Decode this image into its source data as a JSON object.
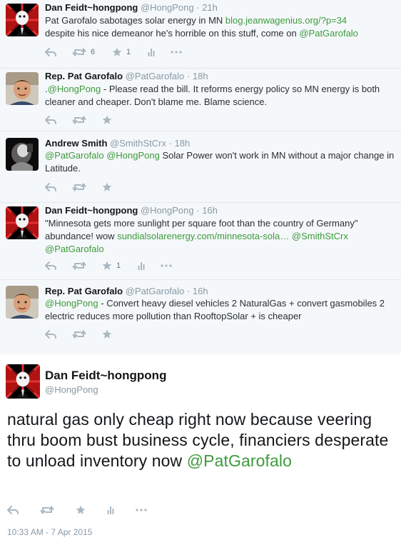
{
  "icons": {
    "reply": "reply-icon",
    "retweet": "retweet-icon",
    "favorite": "star-icon",
    "stats": "stats-icon",
    "more": "more-icon"
  },
  "colors": {
    "link": "#2b7bb9",
    "green_link": "#3d9a3d",
    "muted": "#8899a6",
    "action_gray": "#aab8c2"
  },
  "tweets": [
    {
      "name": "Dan Feidt~hongpong",
      "handle": "@HongPong",
      "time": "21h",
      "line1_text": "Pat Garofalo sabotages solar energy in MN ",
      "line1_link": "blog.jeanwagenius.org/?p=34",
      "line2_text": "despite his nice demeanor he's horrible on this stuff, come on ",
      "line2_mention": "@PatGarofalo",
      "retweets": "6",
      "favorites": "1"
    },
    {
      "name": "Rep. Pat Garofalo",
      "handle": "@PatGarofalo",
      "time": "18h",
      "text_pre": ".",
      "mention": "@HongPong",
      "text": " - Please read the bill. It reforms energy policy so MN energy is both cleaner and cheaper. Don't blame me. Blame science."
    },
    {
      "name": "Andrew Smith",
      "handle": "@SmithStCrx",
      "time": "18h",
      "mention1": "@PatGarofalo",
      "mention2": "@HongPong",
      "text": " Solar Power won't work in MN without a major change in Latitude."
    },
    {
      "name": "Dan Feidt~hongpong",
      "handle": "@HongPong",
      "time": "16h",
      "text1": "\"Minnesota gets more sunlight per square foot than the country of Germany\" abundance! wow ",
      "link": "sundialsolarenergy.com/minnesota-sola…",
      "mention1": "@SmithStCrx",
      "mention2": "@PatGarofalo",
      "favorites": "1"
    },
    {
      "name": "Rep. Pat Garofalo",
      "handle": "@PatGarofalo",
      "time": "16h",
      "mention": "@HongPong",
      "text": " - Convert heavy diesel vehicles 2 NaturalGas + convert gasmobiles 2 electric reduces more pollution than RooftopSolar + is cheaper"
    }
  ],
  "main": {
    "name": "Dan Feidt~hongpong",
    "handle": "@HongPong",
    "text": "natural gas only cheap right now because veering thru boom bust business cycle, financiers desperate to unload inventory now ",
    "mention": "@PatGarofalo",
    "timestamp": "10:33 AM - 7 Apr 2015"
  }
}
